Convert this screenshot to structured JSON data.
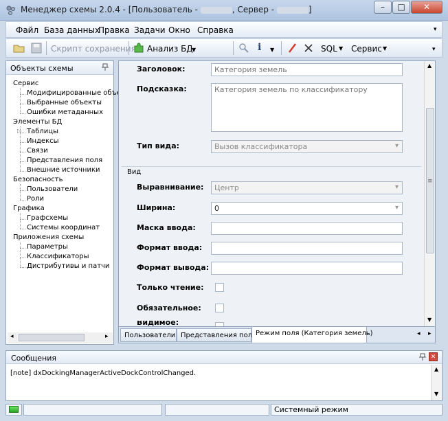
{
  "window": {
    "title_prefix": "Менеджер схемы 2.0.4 - [Пользователь -",
    "title_mid": ", Сервер -",
    "title_suffix": "]",
    "min": "–",
    "max": "□",
    "close": "✕"
  },
  "menu": [
    "Файл",
    "База данных",
    "Правка",
    "Задачи",
    "Окно",
    "Справка"
  ],
  "toolbar": {
    "script_label": "Скрипт сохранения",
    "analyze_label": "Анализ БД",
    "sql_label": "SQL",
    "service_label": "Сервис"
  },
  "left_panel": {
    "title": "Объекты схемы",
    "tree": [
      {
        "label": "Сервис",
        "level": 0
      },
      {
        "label": "Модифицированные объе",
        "level": 1
      },
      {
        "label": "Выбранные объекты",
        "level": 1
      },
      {
        "label": "Ошибки метаданных",
        "level": 1
      },
      {
        "label": "Элементы БД",
        "level": 0
      },
      {
        "label": "Таблицы",
        "level": 1,
        "expand": "▷"
      },
      {
        "label": "Индексы",
        "level": 1
      },
      {
        "label": "Связи",
        "level": 1
      },
      {
        "label": "Представления поля",
        "level": 1
      },
      {
        "label": "Внешние источники",
        "level": 1
      },
      {
        "label": "Безопасность",
        "level": 0
      },
      {
        "label": "Пользователи",
        "level": 1
      },
      {
        "label": "Роли",
        "level": 1
      },
      {
        "label": "Графика",
        "level": 0
      },
      {
        "label": "Графсхемы",
        "level": 1
      },
      {
        "label": "Системы координат",
        "level": 1
      },
      {
        "label": "Приложения схемы",
        "level": 0
      },
      {
        "label": "Параметры",
        "level": 1
      },
      {
        "label": "Классификаторы",
        "level": 1
      },
      {
        "label": "Дистрибутивы и патчи",
        "level": 1
      }
    ]
  },
  "form": {
    "heading_label": "Заголовок:",
    "heading_value": "Категория земель",
    "hint_label": "Подсказка:",
    "hint_value": "Категория земель по классификатору",
    "view_type_label": "Тип вида:",
    "view_type_value": "Вызов классификатора",
    "group_view": "Вид",
    "align_label": "Выравнивание:",
    "align_value": "Центр",
    "width_label": "Ширина:",
    "width_value": "0",
    "mask_label": "Маска ввода:",
    "mask_value": "",
    "format_in_label": "Формат ввода:",
    "format_in_value": "",
    "format_out_label": "Формат вывода:",
    "format_out_value": "",
    "readonly_label": "Только чтение:",
    "required_label": "Обязательное:",
    "visible_label": "Видимое:"
  },
  "tabs": [
    "Пользователи",
    "Представления поля",
    "Режим поля (Категория земель)"
  ],
  "messages": {
    "title": "Сообщения",
    "lines": [
      "[note] dxDockingManagerActiveDockControlChanged."
    ]
  },
  "status": {
    "mode": "Системный режим"
  }
}
